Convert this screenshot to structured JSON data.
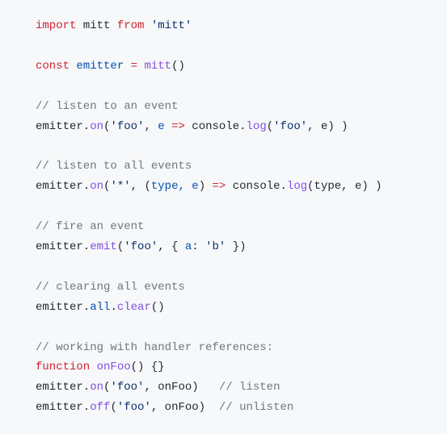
{
  "code": {
    "l1": {
      "kw1": "import",
      "id1": " mitt ",
      "kw2": "from",
      "sp": " ",
      "str": "'mitt'"
    },
    "l2": {
      "kw": "const",
      "sp1": " ",
      "id": "emitter",
      "sp2": " ",
      "op": "=",
      "sp3": " ",
      "fn": "mitt",
      "par": "()"
    },
    "l3": {
      "cmt": "// listen to an event"
    },
    "l4": {
      "p1": "emitter.",
      "fn1": "on",
      "p2": "(",
      "str1": "'foo'",
      "p3": ", ",
      "arg": "e",
      "sp": " ",
      "arrow": "=>",
      "p4": " console.",
      "fn2": "log",
      "p5": "(",
      "str2": "'foo'",
      "p6": ", e) )"
    },
    "l5": {
      "cmt": "// listen to all events"
    },
    "l6": {
      "p1": "emitter.",
      "fn1": "on",
      "p2": "(",
      "str1": "'*'",
      "p3": ", (",
      "args": "type, e",
      "p4": ") ",
      "arrow": "=>",
      "p5": " console.",
      "fn2": "log",
      "p6": "(type, e) )"
    },
    "l7": {
      "cmt": "// fire an event"
    },
    "l8": {
      "p1": "emitter.",
      "fn": "emit",
      "p2": "(",
      "str1": "'foo'",
      "p3": ", { ",
      "prop": "a",
      "p4": ": ",
      "str2": "'b'",
      "p5": " })"
    },
    "l9": {
      "cmt": "// clearing all events"
    },
    "l10": {
      "p1": "emitter.",
      "prop": "all",
      "p2": ".",
      "fn": "clear",
      "p3": "()"
    },
    "l11": {
      "cmt": "// working with handler references:"
    },
    "l12": {
      "kw": "function",
      "sp": " ",
      "fn": "onFoo",
      "par": "() {}"
    },
    "l13": {
      "p1": "emitter.",
      "fn": "on",
      "p2": "(",
      "str": "'foo'",
      "p3": ", onFoo)   ",
      "cmt": "// listen"
    },
    "l14": {
      "p1": "emitter.",
      "fn": "off",
      "p2": "(",
      "str": "'foo'",
      "p3": ", onFoo)  ",
      "cmt": "// unlisten"
    }
  }
}
